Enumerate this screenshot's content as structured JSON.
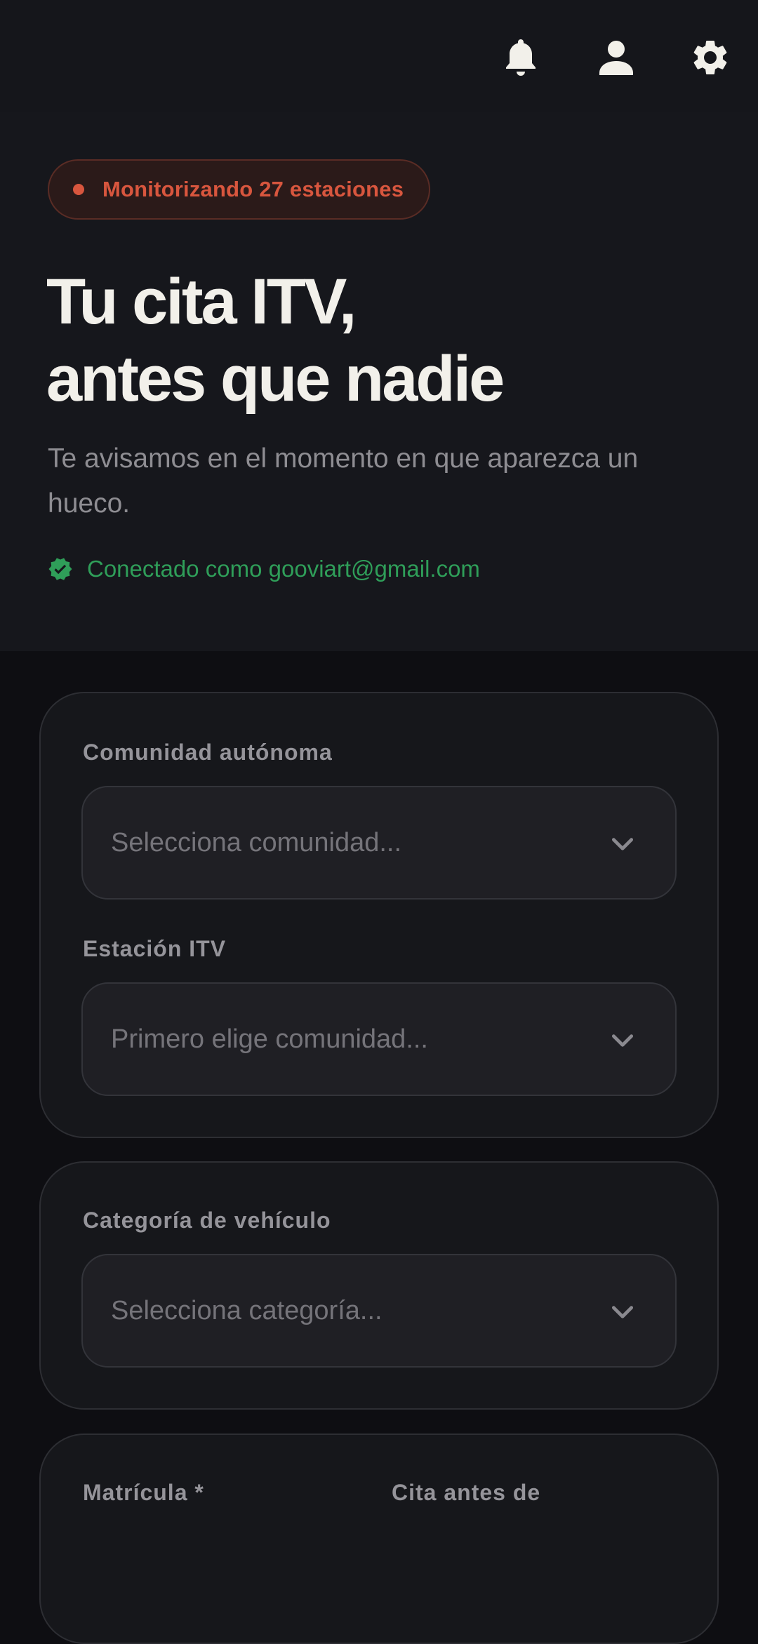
{
  "topbar": {
    "icons": [
      "bell-icon",
      "user-icon",
      "gear-icon"
    ]
  },
  "hero": {
    "badge": "Monitorizando 27 estaciones",
    "title_line1": "Tu cita ITV,",
    "title_line2": "antes que nadie",
    "subtitle": "Te avisamos en el momento en que aparezca un hueco.",
    "connected": "Conectado como gooviart@gmail.com"
  },
  "location_card": {
    "community_label": "Comunidad autónoma",
    "community_placeholder": "Selecciona comunidad...",
    "station_label": "Estación ITV",
    "station_placeholder": "Primero elige comunidad..."
  },
  "vehicle_card": {
    "category_label": "Categoría de vehículo",
    "category_placeholder": "Selecciona categoría..."
  },
  "details_card": {
    "plate_label": "Matrícula *",
    "deadline_label": "Cita antes de"
  },
  "colors": {
    "accent_red": "#d8563e",
    "success_green": "#2f9e59",
    "background": "#0e0e12",
    "card": "#16171b"
  }
}
